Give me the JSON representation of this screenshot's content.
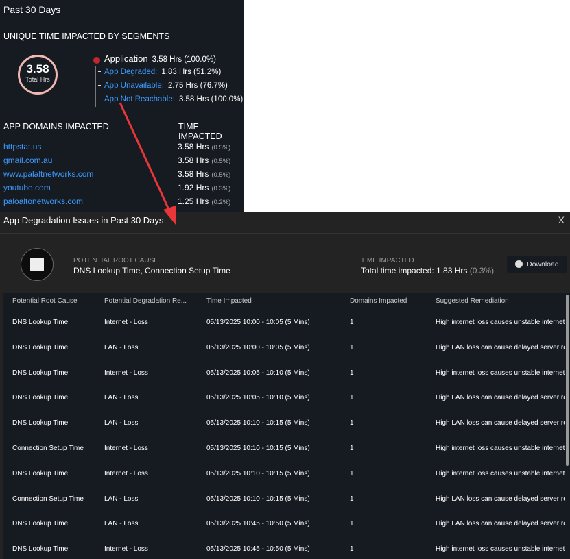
{
  "top": {
    "period": "Past 30 Days",
    "segments_title": "UNIQUE TIME IMPACTED BY SEGMENTS",
    "total_value": "3.58",
    "total_label": "Total Hrs",
    "application": {
      "label": "Application",
      "value": "3.58 Hrs (100.0%)"
    },
    "segments": [
      {
        "label": "App Degraded:",
        "value": "1.83 Hrs (51.2%)"
      },
      {
        "label": "App Unavailable:",
        "value": "2.75 Hrs (76.7%)"
      },
      {
        "label": "App Not Reachable:",
        "value": "3.58 Hrs (100.0%)"
      }
    ],
    "domains_header": "APP DOMAINS IMPACTED",
    "time_header": "TIME IMPACTED",
    "domains": [
      {
        "name": "httpstat.us",
        "time": "3.58 Hrs",
        "pct": "(0.5%)"
      },
      {
        "name": "gmail.com.au",
        "time": "3.58 Hrs",
        "pct": "(0.5%)"
      },
      {
        "name": "www.palaltnetworks.com",
        "time": "3.58 Hrs",
        "pct": "(0.5%)"
      },
      {
        "name": "youtube.com",
        "time": "1.92 Hrs",
        "pct": "(0.3%)"
      },
      {
        "name": "paloaltonetworks.com",
        "time": "1.25 Hrs",
        "pct": "(0.2%)"
      }
    ]
  },
  "modal": {
    "title": "App Degradation Issues in Past 30 Days",
    "close": "X",
    "root_label": "POTENTIAL ROOT CAUSE",
    "root_value": "DNS Lookup Time, Connection Setup Time",
    "time_label": "TIME IMPACTED",
    "time_value": "Total time impacted: 1.83 Hrs",
    "time_pct": "(0.3%)",
    "download": "Download",
    "columns": [
      "Potential Root Cause",
      "Potential Degradation Re...",
      "Time Impacted",
      "Domains Impacted",
      "Suggested Remediation"
    ],
    "rows": [
      [
        "DNS Lookup Time",
        "Internet - Loss",
        "05/13/2025 10:00 - 10:05 (5 Mins)",
        "1",
        "High internet loss causes unstable internet"
      ],
      [
        "DNS Lookup Time",
        "LAN - Loss",
        "05/13/2025 10:00 - 10:05 (5 Mins)",
        "1",
        "High LAN loss can cause delayed server res"
      ],
      [
        "DNS Lookup Time",
        "Internet - Loss",
        "05/13/2025 10:05 - 10:10 (5 Mins)",
        "1",
        "High internet loss causes unstable internet"
      ],
      [
        "DNS Lookup Time",
        "LAN - Loss",
        "05/13/2025 10:05 - 10:10 (5 Mins)",
        "1",
        "High LAN loss can cause delayed server res"
      ],
      [
        "DNS Lookup Time",
        "LAN - Loss",
        "05/13/2025 10:10 - 10:15 (5 Mins)",
        "1",
        "High LAN loss can cause delayed server res"
      ],
      [
        "Connection Setup Time",
        "Internet - Loss",
        "05/13/2025 10:10 - 10:15 (5 Mins)",
        "1",
        "High internet loss causes unstable internet"
      ],
      [
        "DNS Lookup Time",
        "Internet - Loss",
        "05/13/2025 10:10 - 10:15 (5 Mins)",
        "1",
        "High internet loss causes unstable internet"
      ],
      [
        "Connection Setup Time",
        "LAN - Loss",
        "05/13/2025 10:10 - 10:15 (5 Mins)",
        "1",
        "High LAN loss can cause delayed server res"
      ],
      [
        "DNS Lookup Time",
        "LAN - Loss",
        "05/13/2025 10:45 - 10:50 (5 Mins)",
        "1",
        "High LAN loss can cause delayed server res"
      ],
      [
        "DNS Lookup Time",
        "Internet - Loss",
        "05/13/2025 10:45 - 10:50 (5 Mins)",
        "1",
        "High internet loss causes unstable internet"
      ]
    ]
  },
  "colors": {
    "accent": "#3d9bff",
    "application_dot": "#c0282e",
    "arrow": "#e8363a"
  }
}
